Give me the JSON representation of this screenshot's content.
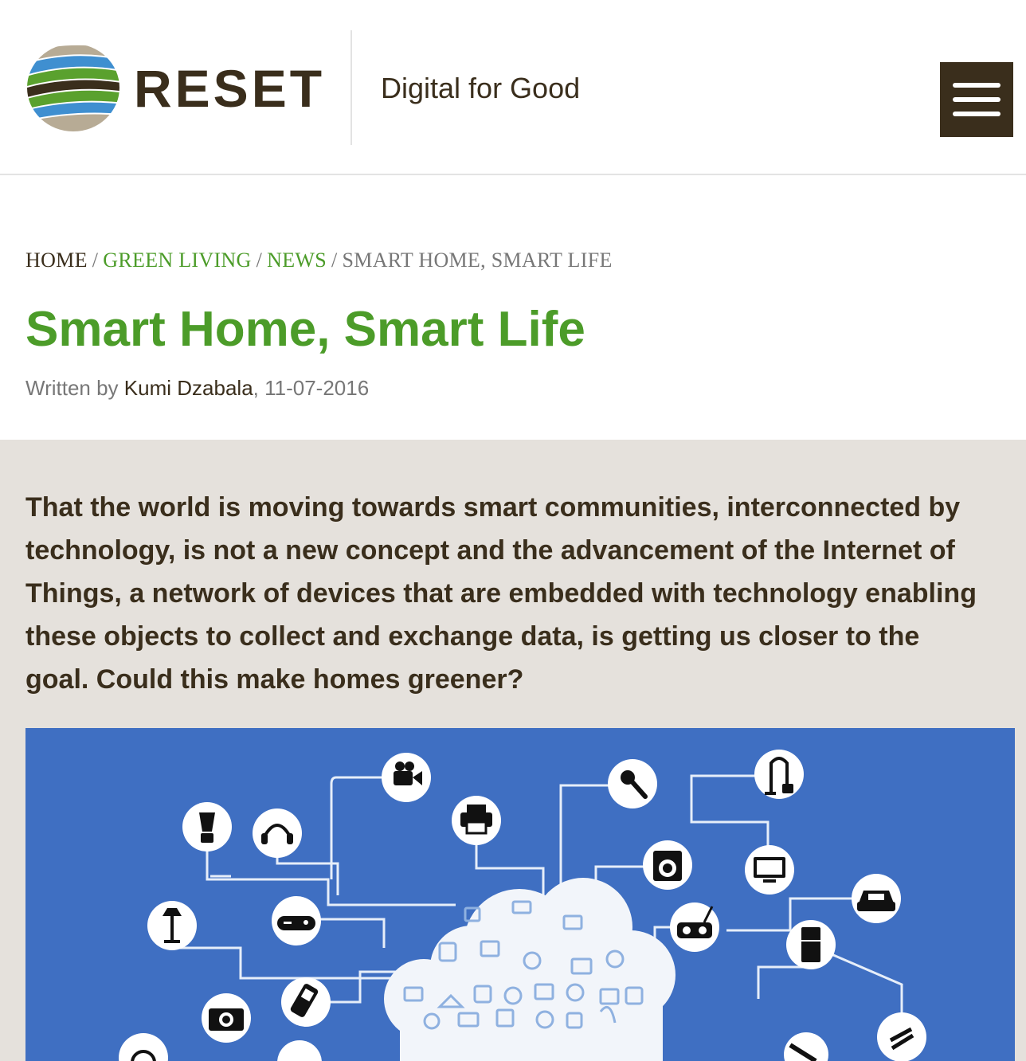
{
  "header": {
    "brand": "RESET",
    "tagline": "Digital for Good",
    "menu_icon": "hamburger-menu-icon"
  },
  "breadcrumb": {
    "home": "HOME",
    "green_living": "GREEN LIVING",
    "news": "NEWS",
    "current": "SMART HOME, SMART LIFE",
    "separator": "/"
  },
  "article": {
    "title": "Smart Home, Smart Life",
    "written_by": "Written by",
    "author": "Kumi Dzabala",
    "date": ", 11-07-2016",
    "lead": "That the world is moving towards smart communities, interconnected by technology, is not a new concept and the advancement of the Internet of Things, a network of devices that are embedded with technology enabling these objects to collect and exchange data, is getting us closer to the goal. Could this make homes greener?"
  },
  "hero_image": {
    "icons": [
      "video-camera-icon",
      "printer-icon",
      "microphone-icon",
      "vacuum-cleaner-icon",
      "blender-icon",
      "headphones-icon",
      "washing-machine-icon",
      "monitor-icon",
      "car-icon",
      "lamp-icon",
      "game-controller-icon",
      "radio-icon",
      "fridge-icon",
      "camera-icon",
      "mobile-phone-icon",
      "cloud-icon"
    ]
  },
  "colors": {
    "brand_dark": "#3a2e1c",
    "accent_green": "#4c9c29",
    "hero_blue": "#3f6fc2",
    "content_bg": "#e5e1dc"
  }
}
